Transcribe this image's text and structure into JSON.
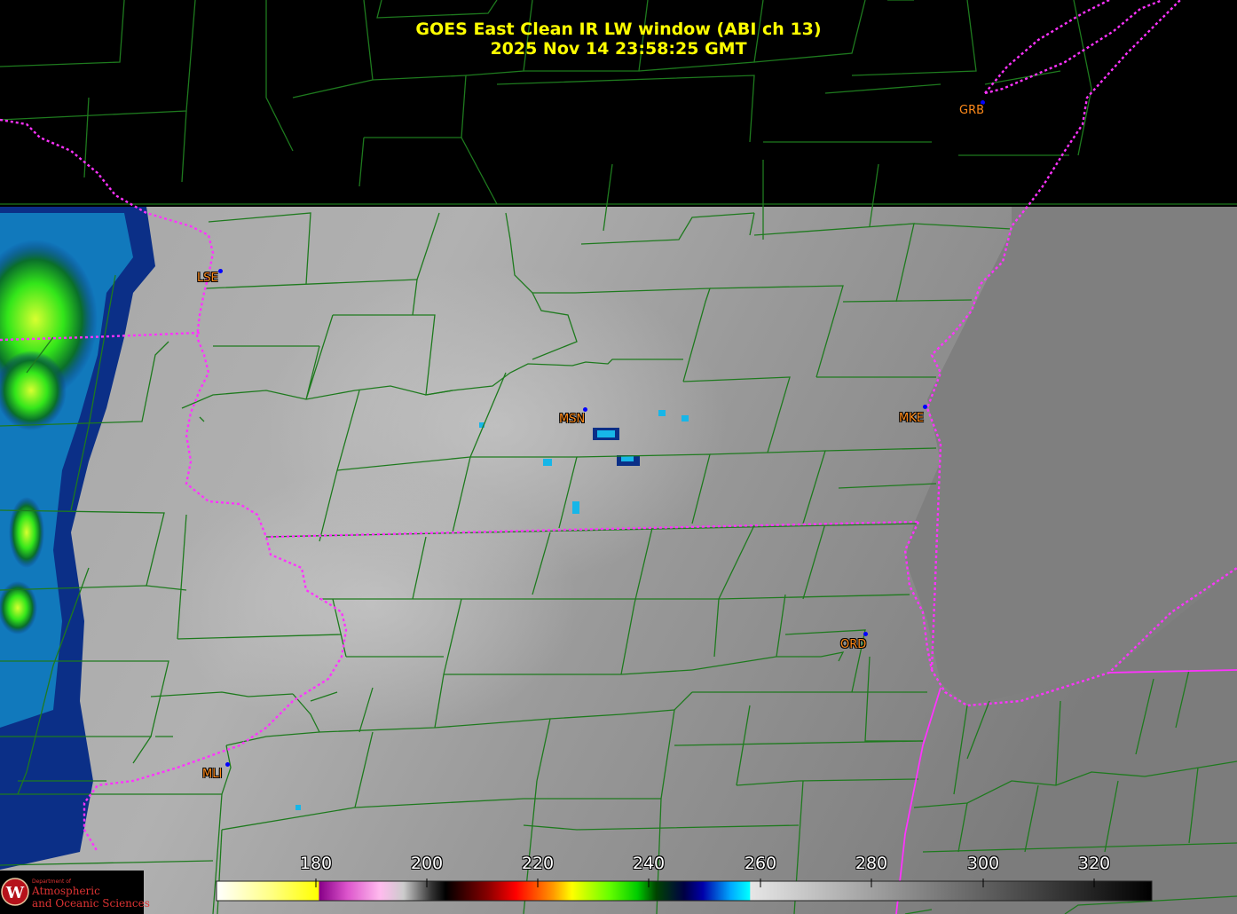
{
  "title": {
    "line1": "GOES East Clean IR LW window (ABI ch 13)",
    "line2": "2025 Nov 14  23:58:25 GMT"
  },
  "cities": [
    {
      "id": "GRB",
      "label": "GRB"
    },
    {
      "id": "LSE",
      "label": "LSE"
    },
    {
      "id": "MSN",
      "label": "MSN"
    },
    {
      "id": "MKE",
      "label": "MKE"
    },
    {
      "id": "ORD",
      "label": "ORD"
    },
    {
      "id": "MLI",
      "label": "MLI"
    }
  ],
  "colorbar": {
    "ticks": [
      "180",
      "200",
      "220",
      "240",
      "260",
      "280",
      "300",
      "320"
    ]
  },
  "logo": {
    "dept": "Department of",
    "line1": "Atmospheric",
    "line2": "and Oceanic Sciences",
    "initial": "W"
  },
  "colors": {
    "title": "#ffff00",
    "county_lines": "#1e7a1e",
    "state_lines": "#ff33ff",
    "city_label": "#ff8a1a",
    "city_dot": "#0000ff"
  }
}
